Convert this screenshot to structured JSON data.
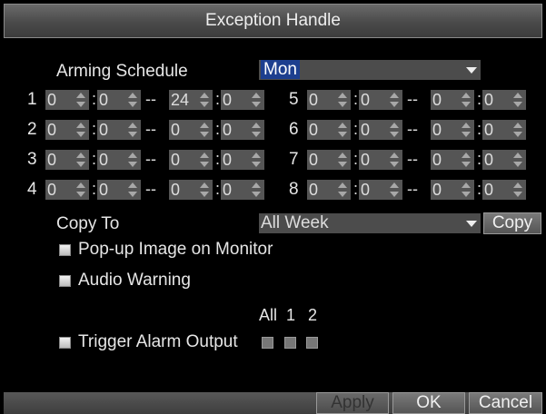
{
  "dialog": {
    "title": "Exception Handle"
  },
  "arming_schedule": {
    "label": "Arming Schedule",
    "day": "Mon"
  },
  "slots": [
    {
      "index": "1",
      "start_h": "0",
      "start_m": "0",
      "end_h": "24",
      "end_m": "0"
    },
    {
      "index": "2",
      "start_h": "0",
      "start_m": "0",
      "end_h": "0",
      "end_m": "0"
    },
    {
      "index": "3",
      "start_h": "0",
      "start_m": "0",
      "end_h": "0",
      "end_m": "0"
    },
    {
      "index": "4",
      "start_h": "0",
      "start_m": "0",
      "end_h": "0",
      "end_m": "0"
    },
    {
      "index": "5",
      "start_h": "0",
      "start_m": "0",
      "end_h": "0",
      "end_m": "0"
    },
    {
      "index": "6",
      "start_h": "0",
      "start_m": "0",
      "end_h": "0",
      "end_m": "0"
    },
    {
      "index": "7",
      "start_h": "0",
      "start_m": "0",
      "end_h": "0",
      "end_m": "0"
    },
    {
      "index": "8",
      "start_h": "0",
      "start_m": "0",
      "end_h": "0",
      "end_m": "0"
    }
  ],
  "separators": {
    "colon": ":",
    "range": "--"
  },
  "copy": {
    "label": "Copy To",
    "target": "All Week",
    "button": "Copy"
  },
  "options": {
    "popup_image": "Pop-up Image on Monitor",
    "audio_warning": "Audio Warning",
    "trigger_alarm": "Trigger Alarm Output"
  },
  "alarm_outputs": {
    "all": "All",
    "ch1": "1",
    "ch2": "2"
  },
  "footer": {
    "apply": "Apply",
    "ok": "OK",
    "cancel": "Cancel"
  },
  "colors": {
    "highlight": "#1d3f8f",
    "background": "#000000",
    "field": "#555555"
  }
}
